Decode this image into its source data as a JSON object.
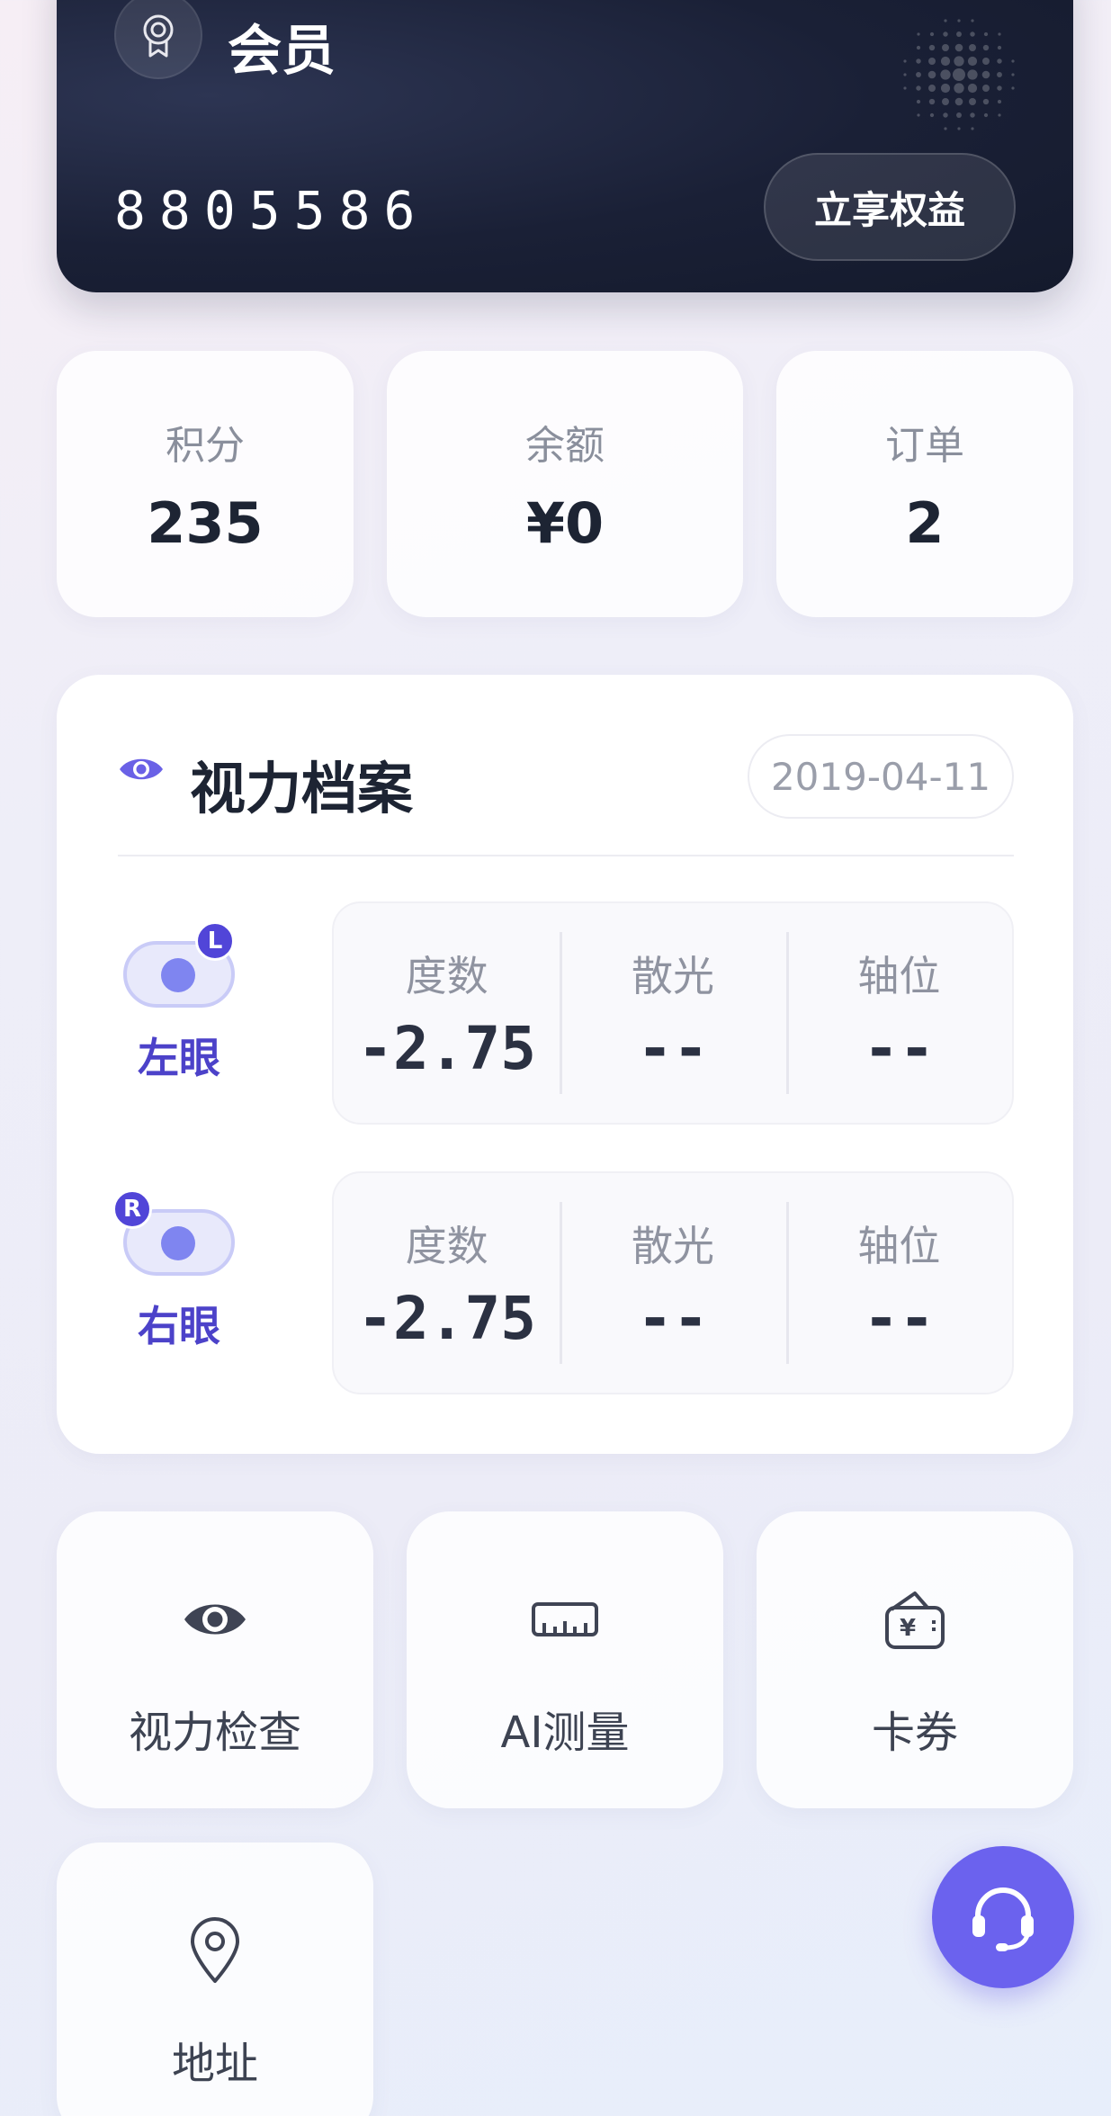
{
  "member_card": {
    "title": "会员",
    "number": "8805586",
    "benefit_button": "立享权益"
  },
  "stats": [
    {
      "label": "积分",
      "value": "235"
    },
    {
      "label": "余额",
      "value": "¥0"
    },
    {
      "label": "订单",
      "value": "2"
    }
  ],
  "vision": {
    "title": "视力档案",
    "date": "2019-04-11",
    "left_eye": {
      "tag": "L",
      "name": "左眼",
      "metrics": [
        {
          "label": "度数",
          "value": "-2.75"
        },
        {
          "label": "散光",
          "value": "--"
        },
        {
          "label": "轴位",
          "value": "--"
        }
      ]
    },
    "right_eye": {
      "tag": "R",
      "name": "右眼",
      "metrics": [
        {
          "label": "度数",
          "value": "-2.75"
        },
        {
          "label": "散光",
          "value": "--"
        },
        {
          "label": "轴位",
          "value": "--"
        }
      ]
    }
  },
  "actions": [
    {
      "label": "视力检查",
      "icon": "eye-icon"
    },
    {
      "label": "AI测量",
      "icon": "ruler-icon"
    },
    {
      "label": "卡券",
      "icon": "wallet-icon"
    },
    {
      "label": "地址",
      "icon": "location-pin-icon"
    }
  ],
  "support_fab": {
    "icon": "headset-icon"
  },
  "colors": {
    "card_dark": "#1a2036",
    "accent": "#5145d8",
    "fab": "#6b62ee"
  }
}
